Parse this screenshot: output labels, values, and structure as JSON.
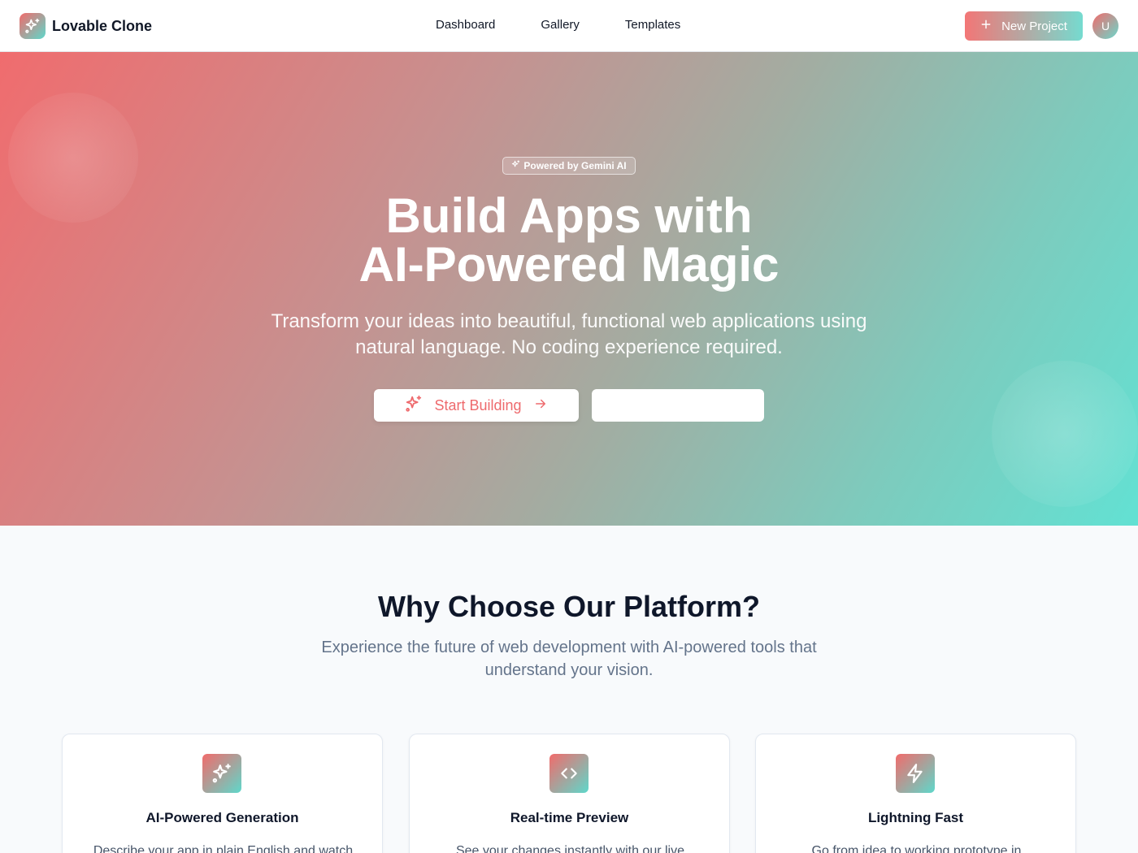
{
  "header": {
    "brand": "Lovable Clone",
    "nav": [
      "Dashboard",
      "Gallery",
      "Templates"
    ],
    "new_project": "New Project",
    "avatar_initial": "U"
  },
  "hero": {
    "badge": "Powered by Gemini AI",
    "title_line1": "Build Apps with",
    "title_line2": "AI-Powered Magic",
    "subtitle": "Transform your ideas into beautiful, functional web applications using natural language. No coding experience required.",
    "cta_primary": "Start Building",
    "cta_secondary": ""
  },
  "features": {
    "title": "Why Choose Our Platform?",
    "subtitle": "Experience the future of web development with AI-powered tools that understand your vision.",
    "cards": [
      {
        "icon": "sparkles-icon",
        "title": "AI-Powered Generation",
        "desc": "Describe your app in plain English and watch"
      },
      {
        "icon": "code-icon",
        "title": "Real-time Preview",
        "desc": "See your changes instantly with our live"
      },
      {
        "icon": "zap-icon",
        "title": "Lightning Fast",
        "desc": "Go from idea to working prototype in"
      }
    ]
  },
  "colors": {
    "accent_coral": "#f26b6b",
    "accent_teal": "#5ed8cb",
    "text_dark": "#0f172a",
    "text_muted": "#64748b"
  }
}
